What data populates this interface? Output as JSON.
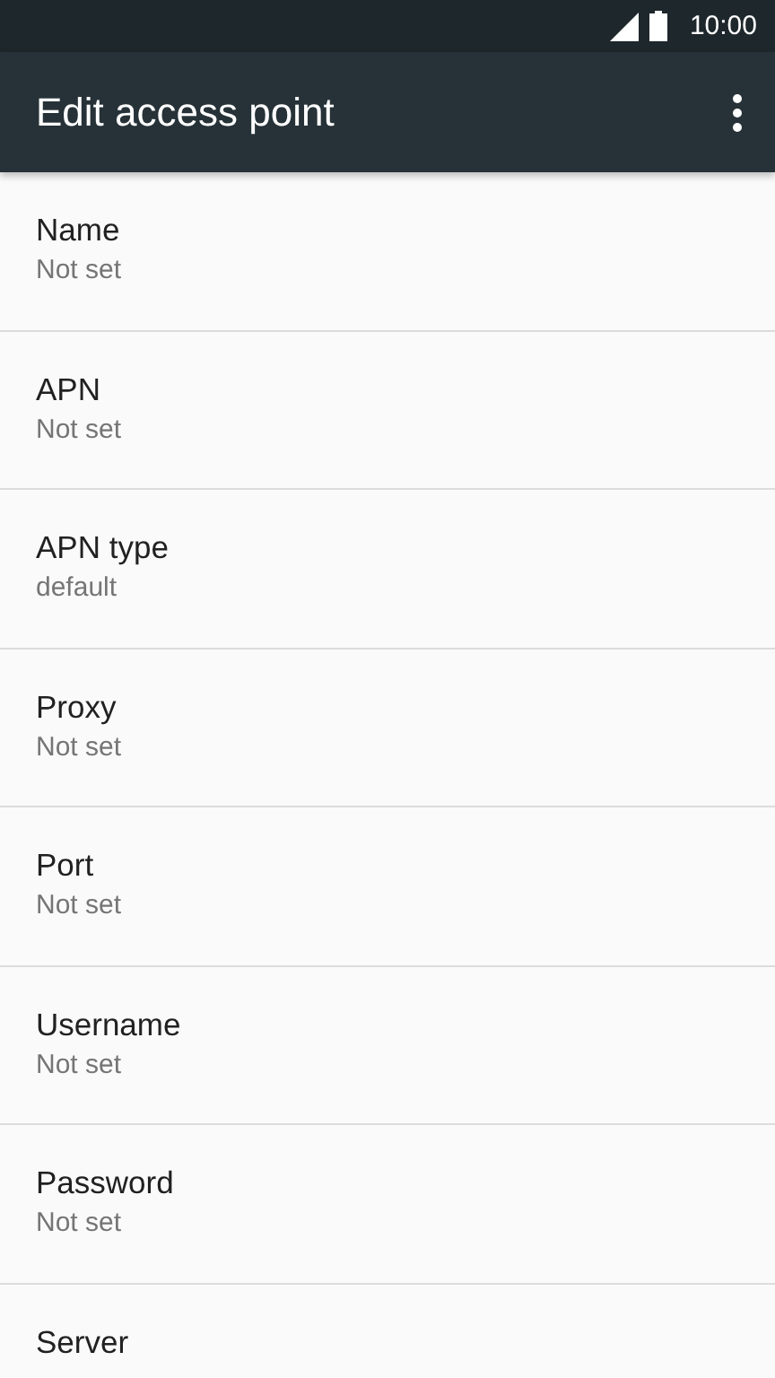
{
  "status_bar": {
    "time": "10:00"
  },
  "toolbar": {
    "title": "Edit access point"
  },
  "settings": [
    {
      "title": "Name",
      "summary": "Not set"
    },
    {
      "title": "APN",
      "summary": "Not set"
    },
    {
      "title": "APN type",
      "summary": "default"
    },
    {
      "title": "Proxy",
      "summary": "Not set"
    },
    {
      "title": "Port",
      "summary": "Not set"
    },
    {
      "title": "Username",
      "summary": "Not set"
    },
    {
      "title": "Password",
      "summary": "Not set"
    },
    {
      "title": "Server"
    }
  ]
}
